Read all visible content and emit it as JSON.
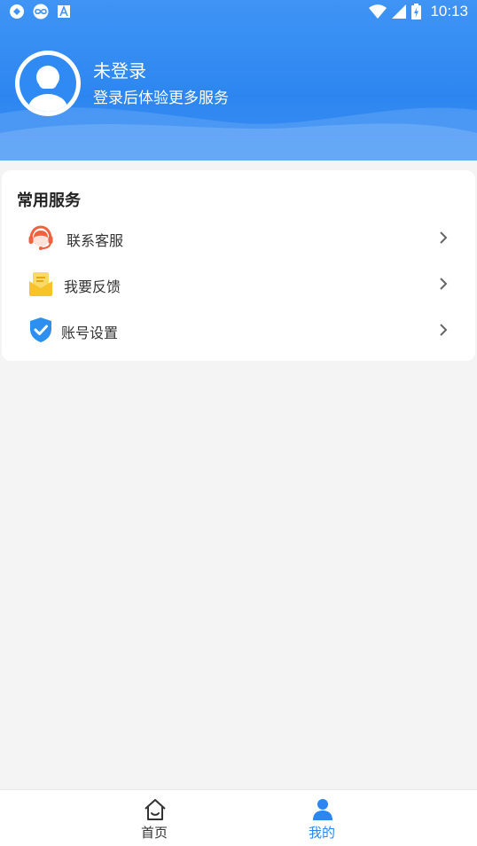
{
  "status_bar": {
    "time": "10:13",
    "icons": [
      "app-notification-icon",
      "loop-icon",
      "font-icon",
      "wifi-icon",
      "signal-icon",
      "battery-icon"
    ]
  },
  "profile": {
    "name": "未登录",
    "subtitle": "登录后体验更多服务",
    "avatar_icon": "avatar-icon"
  },
  "services": {
    "title": "常用服务",
    "items": [
      {
        "label": "联系客服",
        "icon": "headset-icon",
        "color": "#f0623d"
      },
      {
        "label": "我要反馈",
        "icon": "feedback-mail-icon",
        "color": "#f7c32b"
      },
      {
        "label": "账号设置",
        "icon": "shield-check-icon",
        "color": "#2d8ff0"
      }
    ]
  },
  "bottom_nav": {
    "items": [
      {
        "label": "首页",
        "icon": "home-icon",
        "active": false
      },
      {
        "label": "我的",
        "icon": "user-icon",
        "active": true
      }
    ]
  },
  "colors": {
    "primary": "#2d86f0",
    "active_nav": "#2d86f0",
    "inactive_nav": "#333333"
  }
}
